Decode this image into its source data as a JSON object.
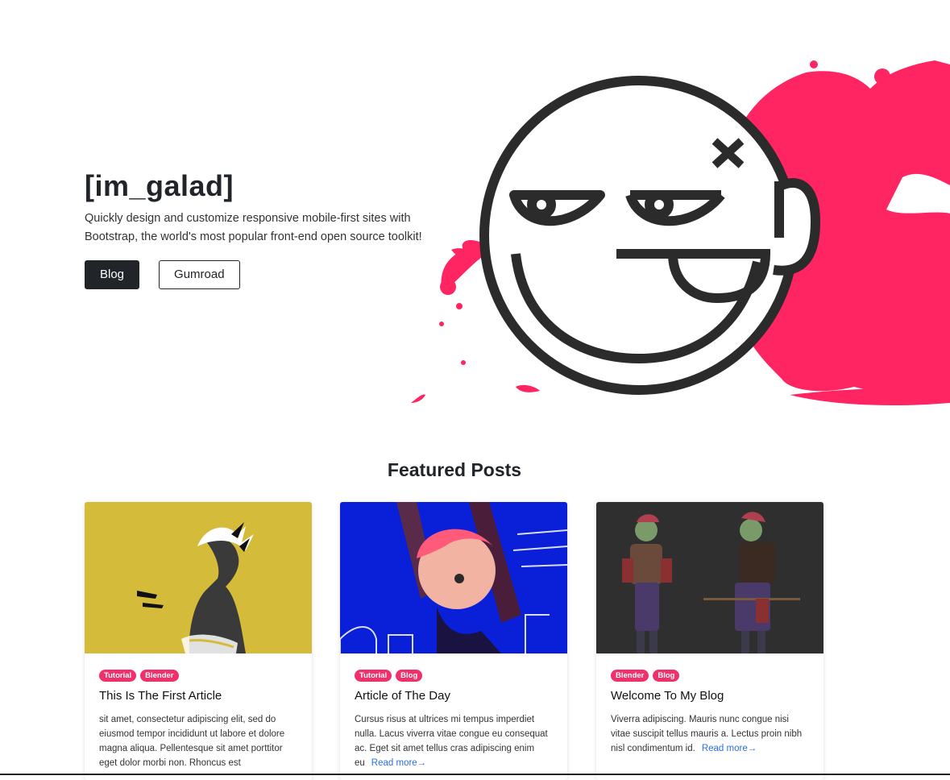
{
  "hero": {
    "title": "[im_galad]",
    "description": "Quickly design and customize responsive mobile-first sites with Bootstrap, the world's most popular front-end open source toolkit!",
    "buttons": {
      "blog": "Blog",
      "gumroad": "Gumroad"
    }
  },
  "featured": {
    "title": "Featured Posts",
    "posts": [
      {
        "tags": [
          "Tutorial",
          "Blender"
        ],
        "title": "This Is The First Article",
        "excerpt": "sit amet, consectetur adipiscing elit, sed do eiusmod tempor incididunt ut labore et dolore magna aliqua. Pellentesque sit amet porttitor eget dolor morbi non. Rhoncus est",
        "read_more": ""
      },
      {
        "tags": [
          "Tutorial",
          "Blog"
        ],
        "title": "Article of The Day",
        "excerpt": "Cursus risus at ultrices mi tempus imperdiet nulla. Lacus viverra vitae congue eu consequat ac. Eget sit amet tellus cras adipiscing enim eu",
        "read_more": "Read more→"
      },
      {
        "tags": [
          "Blender",
          "Blog"
        ],
        "title": "Welcome To My Blog",
        "excerpt": "Viverra adipiscing. Mauris nunc congue nisi vitae suscipit tellus mauris a. Lectus proin nibh nisl condimentum id.",
        "read_more": "Read more→"
      }
    ]
  },
  "colors": {
    "accent": "#f0306a",
    "dark": "#212529",
    "link": "#2b6ee6",
    "thumb_yellow": "#d4bc3a",
    "thumb_blue": "#0a1fd8",
    "thumb_dark": "#2f2f2f"
  },
  "icons": {
    "hero_art": "smiley-face-logo-with-paint-splash",
    "card1_image": "anime-character-yellow-background",
    "card2_image": "anime-character-blue-background",
    "card3_image": "character-turnaround-dark-background"
  }
}
